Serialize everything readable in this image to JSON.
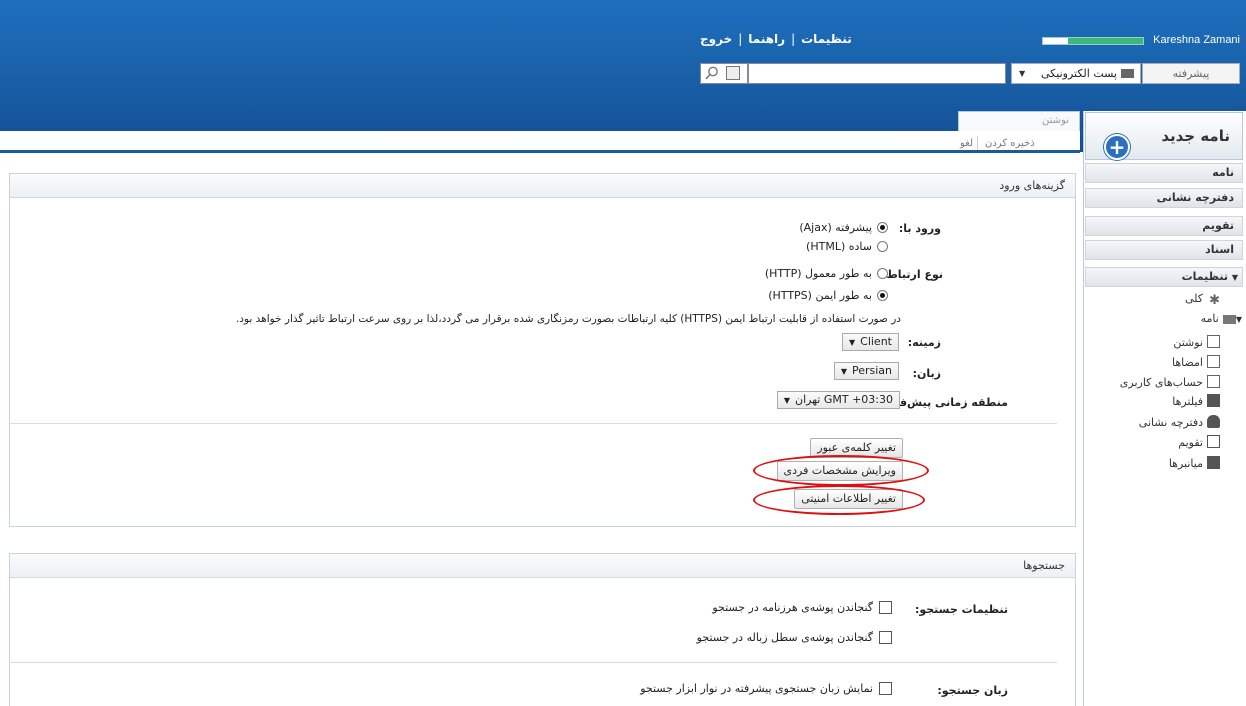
{
  "header": {
    "user_name": "Kareshna Zamani",
    "quota_used_fraction": 0.75,
    "links": [
      "تنظیمات",
      "راهنما",
      "خروج"
    ],
    "advanced_button": "پیشرفته",
    "search_scope": "پست الکترونیکی",
    "search_value": ""
  },
  "compose": {
    "tab_label": "نوشتن",
    "save_label": "ذخیره کردن",
    "cancel_label": "لغو"
  },
  "sidebar": {
    "new_message": "نامه جدید",
    "nav": [
      "نامه",
      "دفترچه نشانی",
      "تقویم",
      "اسناد",
      "تنظیمات"
    ],
    "settings_children": [
      "کلی",
      "نامه"
    ],
    "mail_children": [
      "نوشتن",
      "امضاها",
      "حساب‌های کاربری",
      "فیلترها"
    ],
    "other_children": [
      "دفترچه نشانی",
      "تقویم",
      "میانبرها"
    ]
  },
  "login_panel": {
    "title": "گزینه‌های ورود",
    "login_with_label": "ورود با:",
    "login_options": [
      {
        "label": "پیشرفته (Ajax)",
        "selected": true
      },
      {
        "label": "ساده (HTML)",
        "selected": false
      }
    ],
    "connection_label": "نوع ارتباط",
    "connection_options": [
      {
        "label": "به طور معمول (HTTP)",
        "selected": false
      },
      {
        "label": "به طور ایمن (HTTPS)",
        "selected": true
      }
    ],
    "https_note": "در صورت استفاده از قابلیت ارتباط ایمن (HTTPS) کلیه ارتباطات بصورت رمزنگاری شده برقرار می گردد،لذا بر روی سرعت ارتباط تاثیر گذار خواهد بود.",
    "skin_label": "زمینه:",
    "skin_value": "Client",
    "language_label": "زبان:",
    "language_value": "Persian",
    "timezone_label": "منطقه زمانی پیش‌فرض:",
    "timezone_value": "GMT +03:30 تهران",
    "buttons": {
      "change_password": "تغییر کلمه‌ی عبور",
      "edit_profile": "ویرایش مشخصات فردی",
      "security_info": "تغییر اطلاعات امنیتی"
    }
  },
  "search_panel": {
    "title": "جستجوها",
    "settings_label": "تنظیمات جستجو:",
    "options": [
      {
        "label": "گنجاندن پوشه‌ی هرزنامه در جستجو",
        "checked": false
      },
      {
        "label": "گنجاندن پوشه‌ی سطل زباله در جستجو",
        "checked": false
      }
    ],
    "language_label": "زبان جستجو:",
    "language_option": {
      "label": "نمایش زبان جستجوی پیشرفته در نوار ابزار جستجو",
      "checked": false
    }
  },
  "colors": {
    "header_blue": "#1a62aa",
    "highlight_red": "#dd1111",
    "quota_green": "#3cb878"
  }
}
